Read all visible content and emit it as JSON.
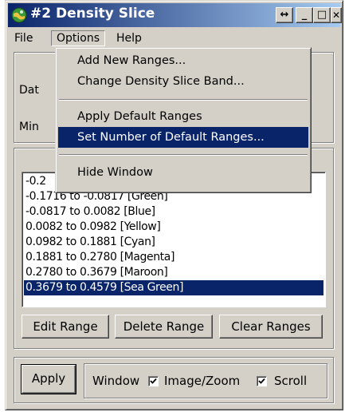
{
  "window": {
    "title": "#2 Density Slice",
    "resize_glyph": "↔",
    "minimize_glyph": "_",
    "maximize_glyph": "□",
    "close_glyph": "✕"
  },
  "menubar": {
    "items": [
      {
        "label": "File"
      },
      {
        "label": "Options"
      },
      {
        "label": "Help"
      }
    ]
  },
  "options_menu": {
    "items": [
      {
        "label": "Add New Ranges..."
      },
      {
        "label": "Change Density Slice Band..."
      },
      {
        "label": "Apply Default Ranges"
      },
      {
        "label": "Set Number of Default Ranges..."
      },
      {
        "label": "Hide Window"
      }
    ],
    "highlighted_index": 3
  },
  "info": {
    "data_label": "Dat",
    "min_label": "Min"
  },
  "ranges": {
    "items": [
      {
        "label": "-0.2"
      },
      {
        "label": "-0.1716 to -0.0817 [Green]"
      },
      {
        "label": "-0.0817 to 0.0082 [Blue]"
      },
      {
        "label": "0.0082 to 0.0982 [Yellow]"
      },
      {
        "label": "0.0982 to 0.1881 [Cyan]"
      },
      {
        "label": "0.1881 to 0.2780 [Magenta]"
      },
      {
        "label": "0.2780 to 0.3679 [Maroon]"
      },
      {
        "label": "0.3679 to 0.4579 [Sea Green]"
      }
    ],
    "selected_index": 7
  },
  "range_buttons": {
    "edit": "Edit Range",
    "delete": "Delete Range",
    "clear": "Clear Ranges"
  },
  "apply_panel": {
    "apply_label": "Apply",
    "window_label": "Window",
    "image_zoom_label": "Image/Zoom",
    "image_zoom_checked": true,
    "scroll_label": "Scroll",
    "scroll_checked": true
  },
  "colors": {
    "selection": "#0a246a",
    "face": "#d4d0c8",
    "title_gradient_end": "#a6caf0"
  }
}
